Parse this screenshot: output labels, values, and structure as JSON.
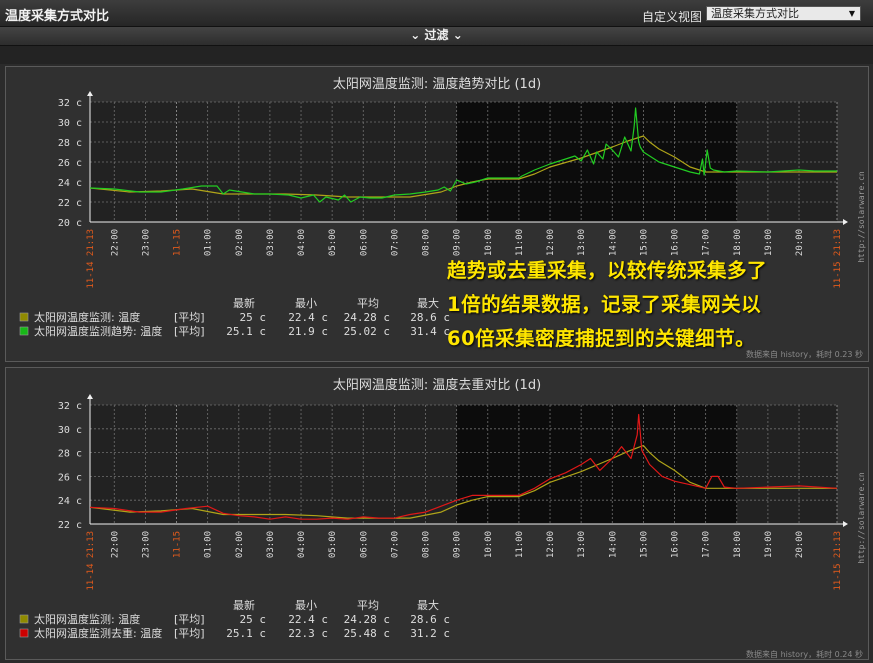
{
  "header": {
    "title": "温度采集方式对比",
    "view_label": "自定义视图",
    "view_selected": "温度采集方式对比"
  },
  "filter": {
    "label": "过滤"
  },
  "overlay_text": [
    "趋势或去重采集，以较传统采集多了",
    "1倍的结果数据，记录了采集网关以",
    "60倍采集密度捕捉到的关键细节。"
  ],
  "colors": {
    "background": "#2b2b2b",
    "plot_bg": "#222222",
    "plot_bg_dark": "#0c0c0c",
    "grid": "#707070",
    "label": "#dddddd",
    "date_label": "#e05a1c",
    "overlay": "#ffe600"
  },
  "chart_data": [
    {
      "type": "line",
      "title": "太阳网温度监测: 温度趋势对比 (1d)",
      "y_ticks": [
        "20 c",
        "22 c",
        "24 c",
        "26 c",
        "28 c",
        "30 c",
        "32 c"
      ],
      "ylim": [
        20,
        32
      ],
      "x_range_hours": [
        21.22,
        45.22
      ],
      "x_time_ticks": [
        "22:00",
        "23:00",
        "01:00",
        "02:00",
        "03:00",
        "04:00",
        "05:00",
        "06:00",
        "07:00",
        "08:00",
        "09:00",
        "10:00",
        "11:00",
        "12:00",
        "13:00",
        "14:00",
        "15:00",
        "16:00",
        "17:00",
        "18:00",
        "19:00",
        "20:00"
      ],
      "x_time_tick_hours": [
        22,
        23,
        25,
        26,
        27,
        28,
        29,
        30,
        31,
        32,
        33,
        34,
        35,
        36,
        37,
        38,
        39,
        40,
        41,
        42,
        43,
        44
      ],
      "date_labels": [
        {
          "text": "11-14 21:13",
          "hour": 21.22
        },
        {
          "text": "11-15",
          "hour": 24
        },
        {
          "text": "11-15 21:13",
          "hour": 45.22
        }
      ],
      "dark_region_hours": [
        33,
        42
      ],
      "watermark": "http://solarware.cn",
      "footer_note": "数据来自 history，耗时 0.23 秒",
      "legend_header": [
        "最新",
        "最小",
        "平均",
        "最大"
      ],
      "series": [
        {
          "name": "太阳网温度监测: 温度",
          "func": "[平均]",
          "stats": [
            "25 c",
            "22.4 c",
            "24.28 c",
            "28.6 c"
          ],
          "color": "#b0a419",
          "legend_color": "#8f8a00",
          "x": [
            21.22,
            22.5,
            23.5,
            24.5,
            25.5,
            26.5,
            27.5,
            28.5,
            29.5,
            30.5,
            31.5,
            32.5,
            33,
            33.5,
            34,
            35,
            35.5,
            36,
            37,
            38,
            38.5,
            39,
            39.2,
            39.5,
            40,
            40.5,
            41,
            41.5,
            42,
            43,
            44,
            45.22
          ],
          "values": [
            23.4,
            23.0,
            23.1,
            23.3,
            22.8,
            22.8,
            22.8,
            22.7,
            22.5,
            22.5,
            22.5,
            23.0,
            23.6,
            24.0,
            24.3,
            24.3,
            24.8,
            25.5,
            26.4,
            27.5,
            28.1,
            28.6,
            28.0,
            27.3,
            26.5,
            25.5,
            25.0,
            25.0,
            25.0,
            25.0,
            25.0,
            25.0
          ]
        },
        {
          "name": "太阳网温度监测趋势: 温度",
          "func": "[平均]",
          "stats": [
            "25.1 c",
            "21.9 c",
            "25.02 c",
            "31.4 c"
          ],
          "color": "#22cc22",
          "legend_color": "#18b818",
          "x": [
            21.22,
            22,
            22.8,
            23.5,
            24.2,
            24.8,
            25.3,
            25.5,
            25.7,
            26.5,
            27,
            27.6,
            28,
            28.4,
            28.6,
            28.8,
            29.2,
            29.4,
            29.6,
            29.9,
            30.2,
            30.6,
            31,
            31.5,
            32,
            32.4,
            32.6,
            32.8,
            33,
            33.3,
            33.6,
            34,
            35,
            35.1,
            35.5,
            36,
            36.5,
            36.8,
            37,
            37.2,
            37.4,
            37.5,
            37.7,
            37.8,
            38.0,
            38.2,
            38.4,
            38.6,
            38.7,
            38.75,
            38.85,
            38.9,
            39,
            39.5,
            40,
            40.5,
            40.8,
            40.9,
            40.95,
            41.05,
            41.15,
            41.25,
            41.6,
            42,
            43,
            43.5,
            44,
            44.5,
            45.22
          ],
          "values": [
            23.4,
            23.3,
            23.0,
            23.0,
            23.3,
            23.6,
            23.6,
            22.8,
            23.2,
            22.8,
            22.8,
            22.7,
            22.4,
            22.7,
            22.0,
            22.5,
            22.2,
            22.7,
            22.0,
            22.5,
            22.4,
            22.4,
            22.7,
            22.8,
            23.0,
            23.2,
            23.5,
            23.1,
            24.2,
            23.8,
            24.0,
            24.4,
            24.4,
            24.6,
            25.2,
            25.8,
            26.3,
            26.6,
            26.1,
            27.2,
            25.8,
            27.0,
            26.3,
            27.8,
            27.2,
            26.5,
            28.5,
            27.1,
            29.5,
            31.4,
            28.0,
            27.5,
            27.0,
            26.0,
            25.5,
            25.0,
            24.8,
            26.3,
            24.7,
            27.2,
            25.4,
            25.2,
            25.0,
            25.1,
            25.0,
            25.1,
            25.2,
            25.1,
            25.1
          ]
        }
      ]
    },
    {
      "type": "line",
      "title": "太阳网温度监测: 温度去重对比 (1d)",
      "y_ticks": [
        "22 c",
        "24 c",
        "26 c",
        "28 c",
        "30 c",
        "32 c"
      ],
      "ylim": [
        22,
        32
      ],
      "x_range_hours": [
        21.22,
        45.22
      ],
      "x_time_ticks": [
        "22:00",
        "23:00",
        "01:00",
        "02:00",
        "03:00",
        "04:00",
        "05:00",
        "06:00",
        "07:00",
        "08:00",
        "09:00",
        "10:00",
        "11:00",
        "12:00",
        "13:00",
        "14:00",
        "15:00",
        "16:00",
        "17:00",
        "18:00",
        "19:00",
        "20:00"
      ],
      "x_time_tick_hours": [
        22,
        23,
        25,
        26,
        27,
        28,
        29,
        30,
        31,
        32,
        33,
        34,
        35,
        36,
        37,
        38,
        39,
        40,
        41,
        42,
        43,
        44
      ],
      "date_labels": [
        {
          "text": "11-14 21:13",
          "hour": 21.22
        },
        {
          "text": "11-15",
          "hour": 24
        },
        {
          "text": "11-15 21:13",
          "hour": 45.22
        }
      ],
      "dark_region_hours": [
        33,
        42
      ],
      "watermark": "http://solarware.cn",
      "footer_note": "数据来自 history，耗时 0.24 秒",
      "legend_header": [
        "最新",
        "最小",
        "平均",
        "最大"
      ],
      "series": [
        {
          "name": "太阳网温度监测: 温度",
          "func": "[平均]",
          "stats": [
            "25 c",
            "22.4 c",
            "24.28 c",
            "28.6 c"
          ],
          "color": "#b0a419",
          "legend_color": "#8f8a00",
          "x": [
            21.22,
            22.5,
            23.5,
            24.5,
            25.5,
            26.5,
            27.5,
            28.5,
            29.5,
            30.5,
            31.5,
            32.5,
            33,
            33.5,
            34,
            35,
            35.5,
            36,
            37,
            38,
            38.5,
            39,
            39.2,
            39.5,
            40,
            40.5,
            41,
            41.5,
            42,
            43,
            44,
            45.22
          ],
          "values": [
            23.4,
            23.0,
            23.1,
            23.3,
            22.8,
            22.8,
            22.8,
            22.7,
            22.5,
            22.5,
            22.5,
            23.0,
            23.6,
            24.0,
            24.3,
            24.3,
            24.8,
            25.5,
            26.4,
            27.5,
            28.1,
            28.6,
            28.0,
            27.3,
            26.5,
            25.5,
            25.0,
            25.0,
            25.0,
            25.0,
            25.0,
            25.0
          ]
        },
        {
          "name": "太阳网温度监测去重: 温度",
          "func": "[平均]",
          "stats": [
            "25.1 c",
            "22.3 c",
            "25.48 c",
            "31.2 c"
          ],
          "color": "#e01818",
          "legend_color": "#cc0000",
          "x": [
            21.22,
            22,
            22.8,
            23.5,
            24.3,
            25,
            25.5,
            26,
            26.5,
            27,
            27.5,
            28,
            28.5,
            29,
            29.5,
            30,
            30.5,
            31,
            31.5,
            32,
            32.5,
            33,
            33.5,
            34,
            35,
            35.5,
            36,
            36.5,
            37,
            37.3,
            37.6,
            38,
            38.3,
            38.6,
            38.8,
            38.85,
            38.95,
            39.2,
            39.6,
            40,
            40.5,
            41,
            41.2,
            41.4,
            41.6,
            42,
            43,
            44,
            45.22
          ],
          "values": [
            23.4,
            23.3,
            23.0,
            23.0,
            23.3,
            23.5,
            22.9,
            22.7,
            22.6,
            22.4,
            22.6,
            22.4,
            22.4,
            22.5,
            22.4,
            22.6,
            22.5,
            22.5,
            22.8,
            23.0,
            23.5,
            24.0,
            24.4,
            24.4,
            24.4,
            25.0,
            25.8,
            26.3,
            27.0,
            27.5,
            26.5,
            27.5,
            28.5,
            27.5,
            29.5,
            31.2,
            28.2,
            27.0,
            26.0,
            25.6,
            25.3,
            25.0,
            26.0,
            26.0,
            25.1,
            25.0,
            25.1,
            25.2,
            25.0
          ]
        }
      ]
    }
  ]
}
